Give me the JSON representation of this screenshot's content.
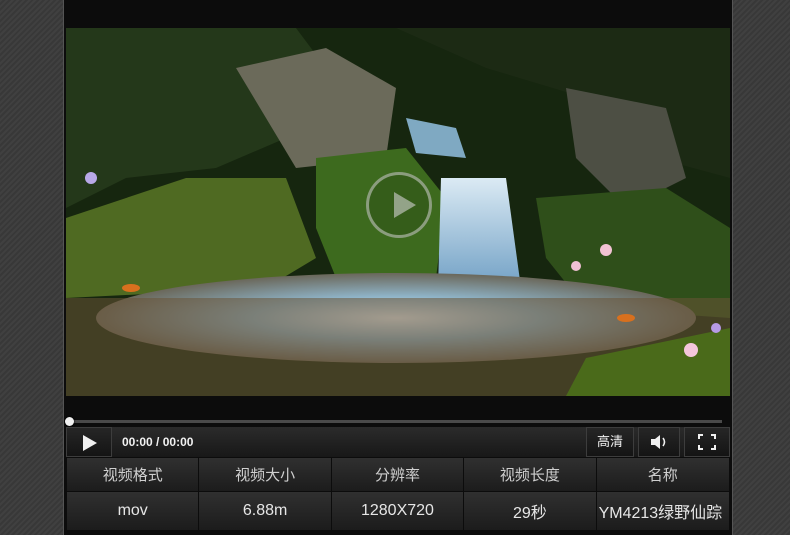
{
  "player": {
    "current_time": "00:00",
    "duration": "00:00",
    "time_separator": " / ",
    "progress_fraction": 0,
    "quality_label": "高清",
    "icons": {
      "play": "play-icon",
      "overlay_play": "play-circle-icon",
      "volume": "speaker-icon",
      "fullscreen": "fullscreen-icon"
    }
  },
  "info_table": {
    "headers": [
      "视频格式",
      "视频大小",
      "分辨率",
      "视频长度",
      "名称"
    ],
    "values": [
      "mov",
      "6.88m",
      "1280X720",
      "29秒",
      "YM4213绿野仙踪"
    ]
  },
  "colors": {
    "page_background": "#3a3a3a",
    "player_background": "#0c0c0c",
    "control_bar": "#1f1f1f",
    "text": "#f2f2f2"
  }
}
